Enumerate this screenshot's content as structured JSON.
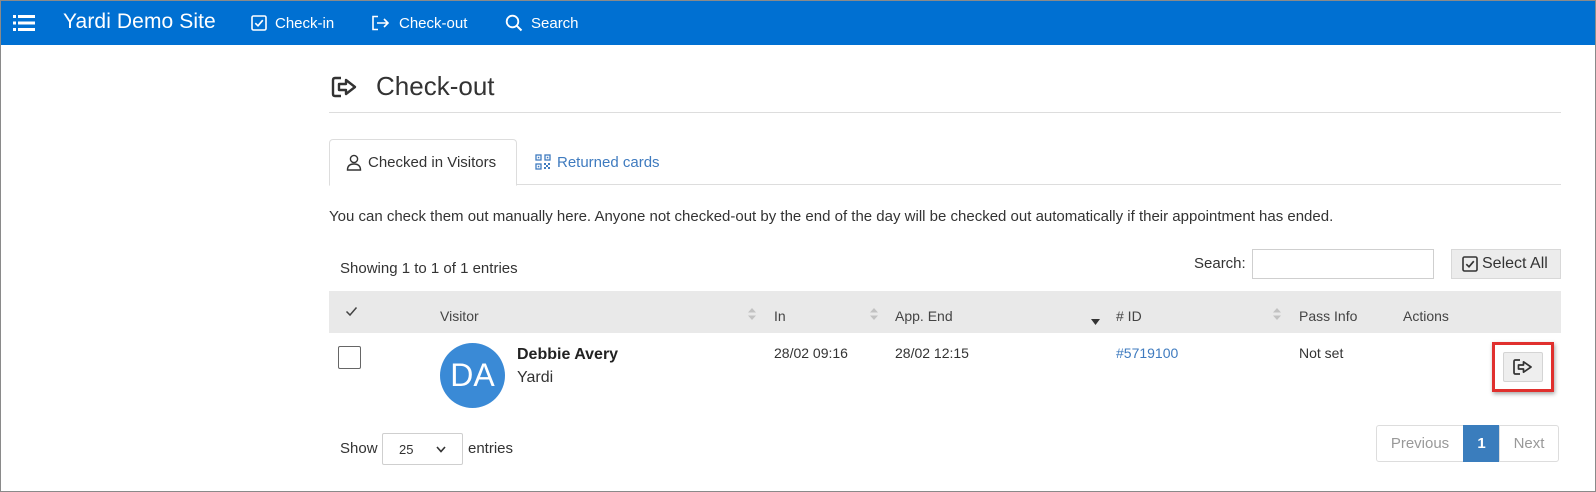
{
  "navbar": {
    "brand": "Yardi Demo Site",
    "links": [
      {
        "label": "Check-in",
        "icon": "checkbox-icon"
      },
      {
        "label": "Check-out",
        "icon": "sign-out-icon"
      },
      {
        "label": "Search",
        "icon": "search-icon"
      }
    ]
  },
  "page": {
    "title": "Check-out"
  },
  "tabs": [
    {
      "label": "Checked in Visitors",
      "icon": "user-icon",
      "active": true
    },
    {
      "label": "Returned cards",
      "icon": "qr-code-icon",
      "active": false
    }
  ],
  "info_text": "You can check them out manually here. Anyone not checked-out by the end of the day will be checked out automatically if their appointment has ended.",
  "table_controls": {
    "showing": "Showing 1 to 1 of 1 entries",
    "search_label": "Search:",
    "search_value": "",
    "select_all_label": "Select All"
  },
  "table": {
    "columns": [
      "Visitor",
      "In",
      "App. End",
      "# ID",
      "Pass Info",
      "Actions"
    ],
    "rows": [
      {
        "initials": "DA",
        "name": "Debbie Avery",
        "company": "Yardi",
        "in": "28/02 09:16",
        "app_end": "28/02 12:15",
        "id": "#5719100",
        "pass_info": "Not set"
      }
    ]
  },
  "footer": {
    "show_label": "Show",
    "page_size": "25",
    "entries_label": "entries",
    "pagination": {
      "previous": "Previous",
      "current": "1",
      "next": "Next"
    }
  },
  "colors": {
    "navbar": "#0070d2",
    "avatar": "#3a8ad6",
    "link": "#3f7bbf",
    "highlight": "#e0302e"
  }
}
